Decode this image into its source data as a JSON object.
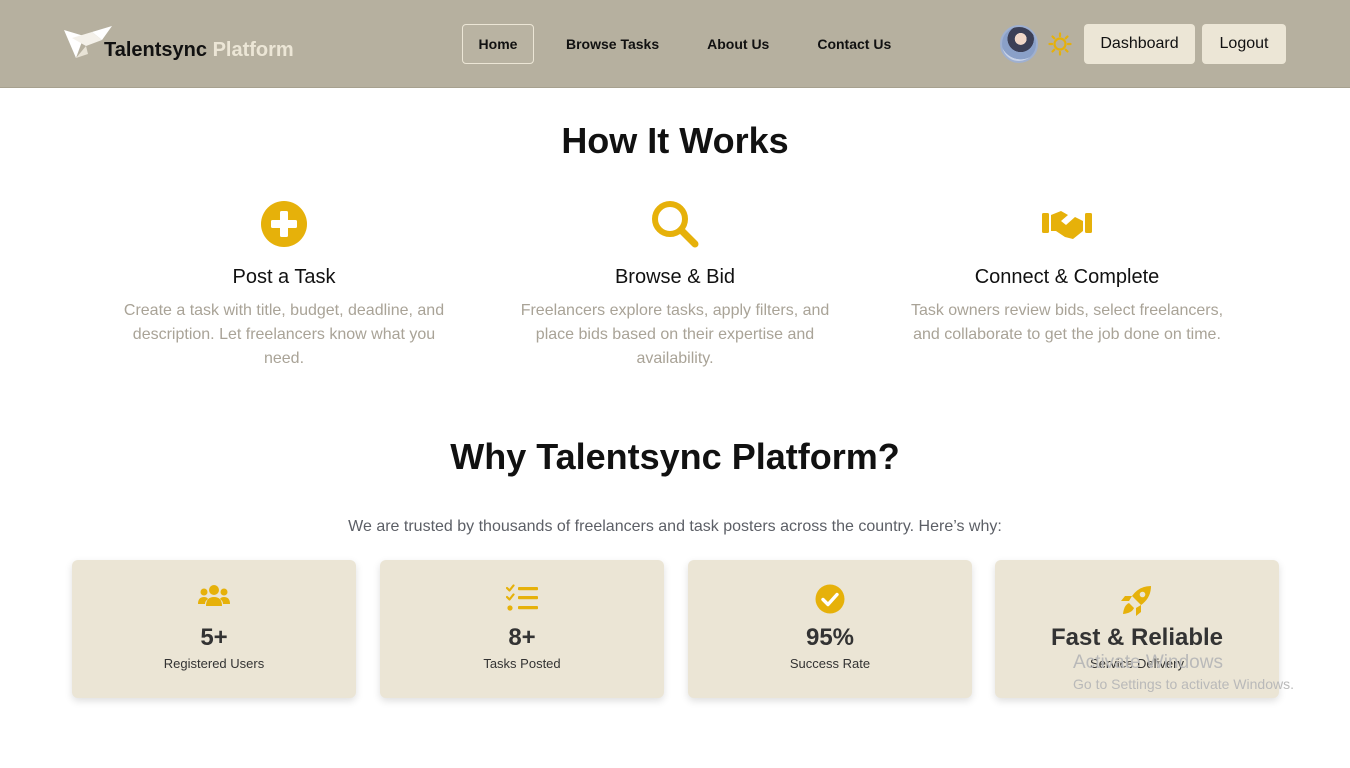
{
  "brand": {
    "name": "Talentsync",
    "accent": "Platform"
  },
  "nav": {
    "links": [
      "Home",
      "Browse Tasks",
      "About Us",
      "Contact Us"
    ],
    "active": "Home",
    "dashboard_label": "Dashboard",
    "logout_label": "Logout"
  },
  "how": {
    "title": "How It Works",
    "steps": [
      {
        "icon": "plus-circle-icon",
        "title": "Post a Task",
        "desc": "Create a task with title, budget, deadline, and description. Let freelancers know what you need."
      },
      {
        "icon": "search-icon",
        "title": "Browse & Bid",
        "desc": "Freelancers explore tasks, apply filters, and place bids based on their expertise and availability."
      },
      {
        "icon": "handshake-icon",
        "title": "Connect & Complete",
        "desc": "Task owners review bids, select freelancers, and collaborate to get the job done on time."
      }
    ]
  },
  "why": {
    "title": "Why Talentsync Platform?",
    "subtitle": "We are trusted by thousands of freelancers and task posters across the country. Here’s why:",
    "stats": [
      {
        "icon": "users-icon",
        "value": "5+",
        "label": "Registered Users"
      },
      {
        "icon": "task-list-icon",
        "value": "8+",
        "label": "Tasks Posted"
      },
      {
        "icon": "check-circle-icon",
        "value": "95%",
        "label": "Success Rate"
      },
      {
        "icon": "rocket-icon",
        "value": "Fast & Reliable",
        "label": "Service Delivery"
      }
    ]
  },
  "watermark": {
    "line1": "Activate Windows",
    "line2": "Go to Settings to activate Windows."
  },
  "colors": {
    "navbar": "#b6b09f",
    "accent": "#e6b10a",
    "card": "#ebe5d5",
    "button": "#ece6d6"
  }
}
